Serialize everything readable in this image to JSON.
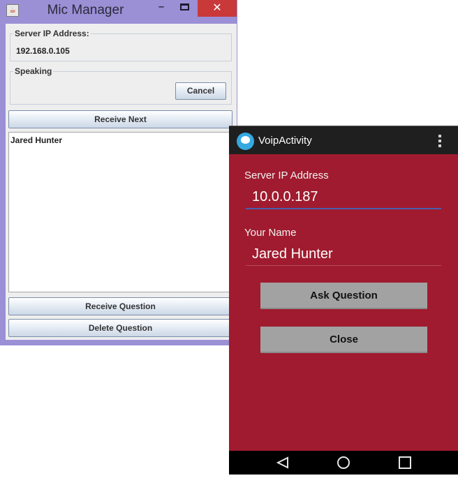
{
  "desktop_window": {
    "title": "Mic Manager",
    "controls": {
      "minimize": "–",
      "close": "✕"
    },
    "server_ip": {
      "legend": "Server IP Address:",
      "value": "192.168.0.105"
    },
    "speaking": {
      "legend": "Speaking",
      "cancel_label": "Cancel"
    },
    "receive_next_label": "Receive Next",
    "queue": [
      "Jared Hunter"
    ],
    "receive_question_label": "Receive Question",
    "delete_question_label": "Delete Question"
  },
  "android_app": {
    "title": "VoipActivity",
    "server_ip": {
      "label": "Server IP Address",
      "value": "10.0.0.187"
    },
    "name": {
      "label": "Your Name",
      "value": "Jared Hunter"
    },
    "ask_label": "Ask Question",
    "close_label": "Close"
  },
  "colors": {
    "swing_frame": "#9b8fd6",
    "close_button": "#c9393a",
    "android_background": "#a01b2f",
    "android_action_bar": "#1f1f1f",
    "focus_underline": "#4a5fae"
  },
  "icons": {
    "java": "java-cup-icon",
    "app": "voip-app-icon",
    "overflow": "overflow-menu-icon",
    "back": "back-triangle-icon",
    "home": "home-circle-icon",
    "recents": "recents-square-icon"
  }
}
